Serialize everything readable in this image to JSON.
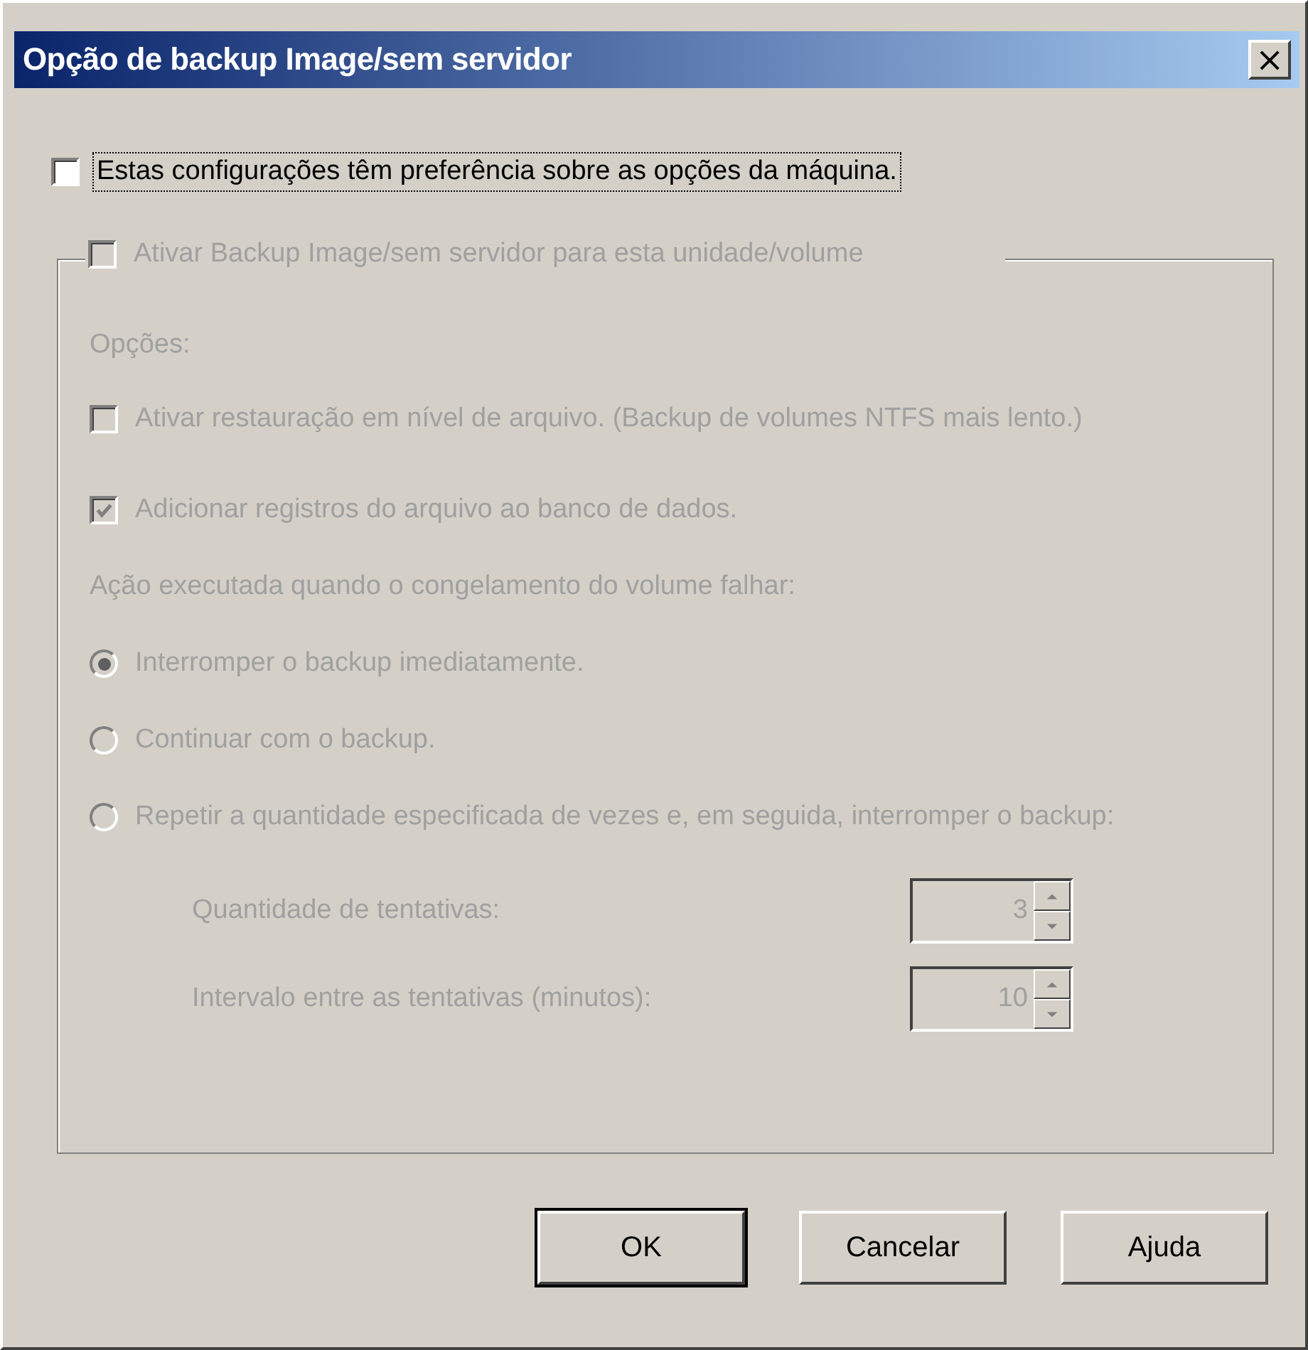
{
  "window": {
    "title": "Opção de backup Image/sem servidor",
    "close_icon": "×"
  },
  "override": {
    "label": "Estas configurações têm preferência sobre as opções da máquina.",
    "checked": false,
    "focused": true
  },
  "group": {
    "label": "Ativar Backup Image/sem servidor para esta unidade/volume",
    "checked": false,
    "disabled": true,
    "options_label": "Opções:",
    "options": [
      {
        "label": "Ativar restauração em nível de arquivo. (Backup de volumes NTFS mais lento.)",
        "checked": false
      },
      {
        "label": "Adicionar registros do arquivo ao banco de dados.",
        "checked": true
      }
    ],
    "action_label": "Ação executada quando o congelamento do volume falhar:",
    "radios": [
      {
        "label": "Interromper o backup imediatamente.",
        "selected": true
      },
      {
        "label": "Continuar com o backup.",
        "selected": false
      },
      {
        "label": "Repetir a quantidade especificada de vezes e, em seguida, interromper o backup:",
        "selected": false
      }
    ],
    "spinners": [
      {
        "label": "Quantidade de tentativas:",
        "value": "3"
      },
      {
        "label": "Intervalo entre as tentativas (minutos):",
        "value": "10"
      }
    ]
  },
  "buttons": [
    {
      "label": "OK",
      "default": true
    },
    {
      "label": "Cancelar",
      "default": false
    },
    {
      "label": "Ajuda",
      "default": false
    }
  ]
}
